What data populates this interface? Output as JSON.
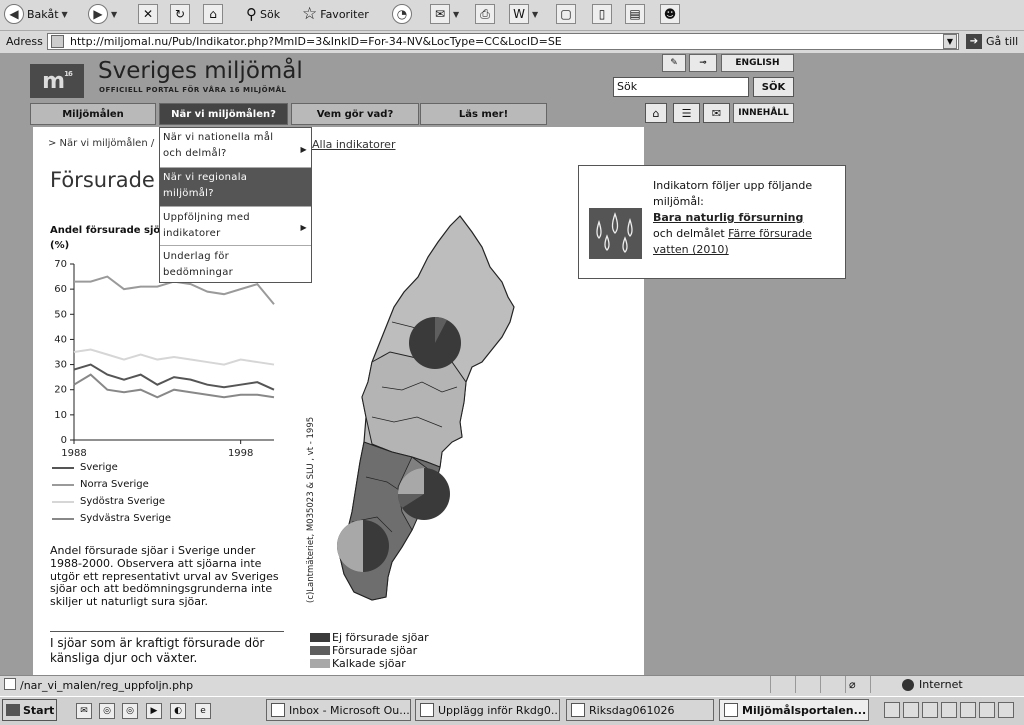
{
  "toolbar": {
    "back": "Bakåt",
    "search": "Sök",
    "favorites": "Favoriter"
  },
  "address": {
    "label": "Adress",
    "url": "http://miljomal.nu/Pub/Indikator.php?MmID=3&InkID=For-34-NV&LocType=CC&LocID=SE",
    "go": "Gå till"
  },
  "site": {
    "logo_mark": "m",
    "logo_badge": "16",
    "title": "Sveriges miljömål",
    "subtitle": "OFFICIELL PORTAL FÖR VÅRA 16 MILJÖMÅL"
  },
  "nav": {
    "items": [
      {
        "label": "Miljömålen"
      },
      {
        "label": "När vi miljömålen?"
      },
      {
        "label": "Vem gör vad?"
      },
      {
        "label": "Läs mer!"
      }
    ]
  },
  "topbar": {
    "english": "ENGLISH",
    "search_value": "Sök",
    "search_button": "SÖK",
    "contents": "INNEHÅLL"
  },
  "breadcrumb": {
    "text": "> När vi miljömålen /",
    "link": "Alla indikatorer"
  },
  "page": {
    "title": "Försurade sjöar",
    "chart_title_1": "Andel försurade sjöar",
    "chart_title_2": "(%)",
    "para1": "Andel försurade sjöar i Sverige under 1988-2000. Observera att sjöarna inte utgör ett representativt urval av Sveriges sjöar och att bedömningsgrunderna inte skiljer ut naturligt sura sjöar.",
    "para2": "I sjöar som är kraftigt försurade dör känsliga djur och växter.",
    "map_credit": "(c)Lantmäteriet, M035023 & SLU , vt - 1995"
  },
  "dropdown": {
    "items": [
      {
        "line1": "När vi nationella mål",
        "line2": "och delmål?",
        "has_sub": true
      },
      {
        "line1": "När vi regionala",
        "line2": "miljömål?",
        "has_sub": false
      },
      {
        "line1": "Uppföljning med",
        "line2": "indikatorer",
        "has_sub": true
      },
      {
        "line1": "Underlag för",
        "line2": "bedömningar",
        "has_sub": false
      }
    ]
  },
  "infobox": {
    "line1": "Indikatorn följer upp följande miljömål:",
    "goal": "Bara naturlig försurning",
    "and": "och delmålet",
    "subgoal": "Färre försurade vatten (2010)"
  },
  "map_legend": [
    {
      "label": "Ej försurade sjöar",
      "color": "#3a3a3a"
    },
    {
      "label": "Försurade sjöar",
      "color": "#5e5e5e"
    },
    {
      "label": "Kalkade sjöar",
      "color": "#a8a8a8"
    }
  ],
  "chart_data": {
    "type": "line",
    "ylabel": "(%)",
    "ylim": [
      0,
      70
    ],
    "yticks": [
      0,
      10,
      20,
      30,
      40,
      50,
      60,
      70
    ],
    "xtick_labels": [
      "1988",
      "1998"
    ],
    "x": [
      1988,
      1989,
      1990,
      1991,
      1992,
      1993,
      1994,
      1995,
      1996,
      1997,
      1998,
      1999,
      2000
    ],
    "series": [
      {
        "name": "Sverige",
        "color": "#555555",
        "values": [
          28,
          30,
          26,
          24,
          26,
          22,
          25,
          24,
          22,
          21,
          22,
          23,
          20
        ]
      },
      {
        "name": "Norra Sverige",
        "color": "#9a9a9a",
        "values": [
          63,
          63,
          65,
          60,
          61,
          61,
          63,
          62,
          59,
          58,
          60,
          62,
          54
        ]
      },
      {
        "name": "Sydöstra Sverige",
        "color": "#d6d6d6",
        "values": [
          35,
          36,
          34,
          32,
          34,
          32,
          33,
          32,
          31,
          30,
          32,
          31,
          30
        ]
      },
      {
        "name": "Sydvästra Sverige",
        "color": "#888888",
        "values": [
          22,
          26,
          20,
          19,
          20,
          17,
          20,
          19,
          18,
          17,
          18,
          18,
          17
        ]
      }
    ]
  },
  "status": {
    "text": "/nar_vi_malen/reg_uppfoljn.php",
    "zone": "Internet"
  },
  "taskbar": {
    "start": "Start",
    "tasks": [
      {
        "label": "Inbox - Microsoft Ou..."
      },
      {
        "label": "Upplägg inför Rkdg0..."
      },
      {
        "label": "Riksdag061026"
      },
      {
        "label": "Miljömålsportalen..."
      }
    ]
  }
}
